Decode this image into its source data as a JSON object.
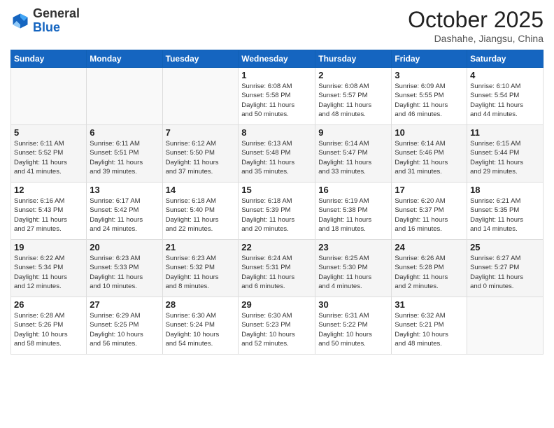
{
  "header": {
    "logo_general": "General",
    "logo_blue": "Blue",
    "month_title": "October 2025",
    "location": "Dashahe, Jiangsu, China"
  },
  "days_of_week": [
    "Sunday",
    "Monday",
    "Tuesday",
    "Wednesday",
    "Thursday",
    "Friday",
    "Saturday"
  ],
  "weeks": [
    [
      {
        "day": "",
        "info": ""
      },
      {
        "day": "",
        "info": ""
      },
      {
        "day": "",
        "info": ""
      },
      {
        "day": "1",
        "info": "Sunrise: 6:08 AM\nSunset: 5:58 PM\nDaylight: 11 hours\nand 50 minutes."
      },
      {
        "day": "2",
        "info": "Sunrise: 6:08 AM\nSunset: 5:57 PM\nDaylight: 11 hours\nand 48 minutes."
      },
      {
        "day": "3",
        "info": "Sunrise: 6:09 AM\nSunset: 5:55 PM\nDaylight: 11 hours\nand 46 minutes."
      },
      {
        "day": "4",
        "info": "Sunrise: 6:10 AM\nSunset: 5:54 PM\nDaylight: 11 hours\nand 44 minutes."
      }
    ],
    [
      {
        "day": "5",
        "info": "Sunrise: 6:11 AM\nSunset: 5:52 PM\nDaylight: 11 hours\nand 41 minutes."
      },
      {
        "day": "6",
        "info": "Sunrise: 6:11 AM\nSunset: 5:51 PM\nDaylight: 11 hours\nand 39 minutes."
      },
      {
        "day": "7",
        "info": "Sunrise: 6:12 AM\nSunset: 5:50 PM\nDaylight: 11 hours\nand 37 minutes."
      },
      {
        "day": "8",
        "info": "Sunrise: 6:13 AM\nSunset: 5:48 PM\nDaylight: 11 hours\nand 35 minutes."
      },
      {
        "day": "9",
        "info": "Sunrise: 6:14 AM\nSunset: 5:47 PM\nDaylight: 11 hours\nand 33 minutes."
      },
      {
        "day": "10",
        "info": "Sunrise: 6:14 AM\nSunset: 5:46 PM\nDaylight: 11 hours\nand 31 minutes."
      },
      {
        "day": "11",
        "info": "Sunrise: 6:15 AM\nSunset: 5:44 PM\nDaylight: 11 hours\nand 29 minutes."
      }
    ],
    [
      {
        "day": "12",
        "info": "Sunrise: 6:16 AM\nSunset: 5:43 PM\nDaylight: 11 hours\nand 27 minutes."
      },
      {
        "day": "13",
        "info": "Sunrise: 6:17 AM\nSunset: 5:42 PM\nDaylight: 11 hours\nand 24 minutes."
      },
      {
        "day": "14",
        "info": "Sunrise: 6:18 AM\nSunset: 5:40 PM\nDaylight: 11 hours\nand 22 minutes."
      },
      {
        "day": "15",
        "info": "Sunrise: 6:18 AM\nSunset: 5:39 PM\nDaylight: 11 hours\nand 20 minutes."
      },
      {
        "day": "16",
        "info": "Sunrise: 6:19 AM\nSunset: 5:38 PM\nDaylight: 11 hours\nand 18 minutes."
      },
      {
        "day": "17",
        "info": "Sunrise: 6:20 AM\nSunset: 5:37 PM\nDaylight: 11 hours\nand 16 minutes."
      },
      {
        "day": "18",
        "info": "Sunrise: 6:21 AM\nSunset: 5:35 PM\nDaylight: 11 hours\nand 14 minutes."
      }
    ],
    [
      {
        "day": "19",
        "info": "Sunrise: 6:22 AM\nSunset: 5:34 PM\nDaylight: 11 hours\nand 12 minutes."
      },
      {
        "day": "20",
        "info": "Sunrise: 6:23 AM\nSunset: 5:33 PM\nDaylight: 11 hours\nand 10 minutes."
      },
      {
        "day": "21",
        "info": "Sunrise: 6:23 AM\nSunset: 5:32 PM\nDaylight: 11 hours\nand 8 minutes."
      },
      {
        "day": "22",
        "info": "Sunrise: 6:24 AM\nSunset: 5:31 PM\nDaylight: 11 hours\nand 6 minutes."
      },
      {
        "day": "23",
        "info": "Sunrise: 6:25 AM\nSunset: 5:30 PM\nDaylight: 11 hours\nand 4 minutes."
      },
      {
        "day": "24",
        "info": "Sunrise: 6:26 AM\nSunset: 5:28 PM\nDaylight: 11 hours\nand 2 minutes."
      },
      {
        "day": "25",
        "info": "Sunrise: 6:27 AM\nSunset: 5:27 PM\nDaylight: 11 hours\nand 0 minutes."
      }
    ],
    [
      {
        "day": "26",
        "info": "Sunrise: 6:28 AM\nSunset: 5:26 PM\nDaylight: 10 hours\nand 58 minutes."
      },
      {
        "day": "27",
        "info": "Sunrise: 6:29 AM\nSunset: 5:25 PM\nDaylight: 10 hours\nand 56 minutes."
      },
      {
        "day": "28",
        "info": "Sunrise: 6:30 AM\nSunset: 5:24 PM\nDaylight: 10 hours\nand 54 minutes."
      },
      {
        "day": "29",
        "info": "Sunrise: 6:30 AM\nSunset: 5:23 PM\nDaylight: 10 hours\nand 52 minutes."
      },
      {
        "day": "30",
        "info": "Sunrise: 6:31 AM\nSunset: 5:22 PM\nDaylight: 10 hours\nand 50 minutes."
      },
      {
        "day": "31",
        "info": "Sunrise: 6:32 AM\nSunset: 5:21 PM\nDaylight: 10 hours\nand 48 minutes."
      },
      {
        "day": "",
        "info": ""
      }
    ]
  ]
}
